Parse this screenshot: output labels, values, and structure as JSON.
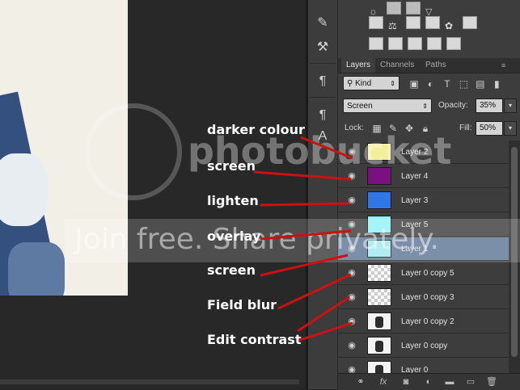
{
  "layers_panel": {
    "tabs": [
      "Layers",
      "Channels",
      "Paths"
    ],
    "filter": {
      "label": "Kind"
    },
    "blend_mode": "Screen",
    "opacity_label": "Opacity:",
    "opacity_value": "35%",
    "lock_label": "Lock:",
    "fill_label": "Fill:",
    "fill_value": "50%",
    "layers": [
      {
        "name": "Layer 2",
        "thumb_color": "#f1ee9c",
        "thumb": "color"
      },
      {
        "name": "Layer 4",
        "thumb_color": "#7b117e",
        "thumb": "color"
      },
      {
        "name": "Layer 3",
        "thumb_color": "#2f76e6",
        "thumb": "color"
      },
      {
        "name": "Layer 5",
        "thumb_color": "#8ff3f9",
        "thumb": "color"
      },
      {
        "name": "Layer 1",
        "thumb_color": "#9fe9ef",
        "thumb": "color",
        "selected": true
      },
      {
        "name": "Layer 0 copy 5",
        "thumb": "checker"
      },
      {
        "name": "Layer 0 copy 3",
        "thumb": "checker"
      },
      {
        "name": "Layer 0 copy 2",
        "thumb": "photo"
      },
      {
        "name": "Layer 0 copy",
        "thumb": "photo"
      },
      {
        "name": "Layer 0",
        "thumb": "photo"
      }
    ]
  },
  "annotations": {
    "darker_colour": "darker colour",
    "screen_1": "screen",
    "lighten": "lighten",
    "overlay": "overlay",
    "screen_2": "screen",
    "field_blur": "Field blur",
    "edit_contrast": "Edit contrast"
  },
  "watermark": {
    "brand": "photobucket",
    "tagline": "Join free. Share privately."
  },
  "colors": {
    "arrow": "#cc1111",
    "selected_layer": "#5e7796"
  }
}
